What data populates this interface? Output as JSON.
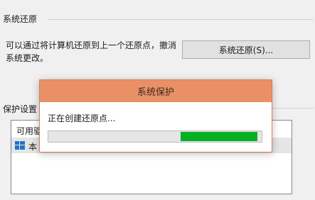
{
  "restore_group": {
    "title": "系统还原",
    "description_line1": "可以通过将计算机还原到上一个还原点，撤消",
    "description_line2": "系统更改。",
    "restore_button": "系统还原(S)..."
  },
  "protection_group": {
    "title": "保护设置",
    "list_header": "可用驱",
    "drive_label": "本"
  },
  "dialog": {
    "title": "系统保护",
    "message": "正在创建还原点...",
    "progress_segment": {
      "start_fraction": 0.62,
      "end_fraction": 0.98
    }
  },
  "colors": {
    "dialog_title_bar": "#e99066",
    "progress_fill": "#06b025"
  },
  "icons": {
    "drive": "windows-drive-icon"
  }
}
